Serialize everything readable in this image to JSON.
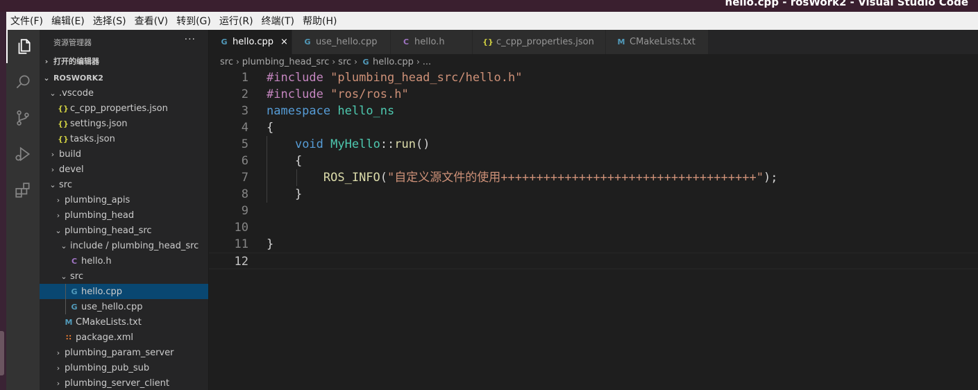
{
  "window": {
    "title": "hello.cpp - rosWork2 - Visual Studio Code"
  },
  "menubar": {
    "items": [
      "文件(F)",
      "编辑(E)",
      "选择(S)",
      "查看(V)",
      "转到(G)",
      "运行(R)",
      "终端(T)",
      "帮助(H)"
    ]
  },
  "activity_bar": {
    "items": [
      {
        "icon": "files-icon",
        "active": true
      },
      {
        "icon": "search-icon",
        "active": false
      },
      {
        "icon": "source-control-icon",
        "active": false
      },
      {
        "icon": "run-debug-icon",
        "active": false
      },
      {
        "icon": "extensions-icon",
        "active": false
      }
    ]
  },
  "sidebar": {
    "title": "资源管理器",
    "more": "···",
    "open_editors": "打开的编辑器",
    "workspace": "ROSWORK2",
    "tree": [
      {
        "label": ".vscode",
        "type": "folder",
        "open": true
      },
      {
        "label": "c_cpp_properties.json",
        "type": "json",
        "icon": "{}"
      },
      {
        "label": "settings.json",
        "type": "json",
        "icon": "{}"
      },
      {
        "label": "tasks.json",
        "type": "json",
        "icon": "{}"
      },
      {
        "label": "build",
        "type": "folder",
        "open": false
      },
      {
        "label": "devel",
        "type": "folder",
        "open": false
      },
      {
        "label": "src",
        "type": "folder",
        "open": true
      },
      {
        "label": "plumbing_apis",
        "type": "folder",
        "open": false
      },
      {
        "label": "plumbing_head",
        "type": "folder",
        "open": false
      },
      {
        "label": "plumbing_head_src",
        "type": "folder",
        "open": true
      },
      {
        "label": "include / plumbing_head_src",
        "type": "folder",
        "open": true
      },
      {
        "label": "hello.h",
        "type": "c",
        "icon": "C"
      },
      {
        "label": "src",
        "type": "folder",
        "open": true
      },
      {
        "label": "hello.cpp",
        "type": "cpp",
        "icon": "G",
        "selected": true
      },
      {
        "label": "use_hello.cpp",
        "type": "cpp",
        "icon": "G"
      },
      {
        "label": "CMakeLists.txt",
        "type": "cmake",
        "icon": "M"
      },
      {
        "label": "package.xml",
        "type": "xml",
        "icon": "∷"
      },
      {
        "label": "plumbing_param_server",
        "type": "folder",
        "open": false
      },
      {
        "label": "plumbing_pub_sub",
        "type": "folder",
        "open": false
      },
      {
        "label": "plumbing_server_client",
        "type": "folder",
        "open": false
      }
    ]
  },
  "tabs": [
    {
      "label": "hello.cpp",
      "icon": "G",
      "type": "cpp",
      "active": true,
      "close": "×"
    },
    {
      "label": "use_hello.cpp",
      "icon": "G",
      "type": "cpp",
      "active": false
    },
    {
      "label": "hello.h",
      "icon": "C",
      "type": "c",
      "active": false
    },
    {
      "label": "c_cpp_properties.json",
      "icon": "{}",
      "type": "json",
      "active": false
    },
    {
      "label": "CMakeLists.txt",
      "icon": "M",
      "type": "cmake",
      "active": false
    }
  ],
  "breadcrumb": {
    "parts": [
      "src",
      "plumbing_head_src",
      "src",
      "hello.cpp",
      "..."
    ],
    "file_icon": "G"
  },
  "editor": {
    "current_line": 12,
    "lines": [
      {
        "num": "1",
        "tokens": [
          {
            "t": "pre",
            "v": "#include "
          },
          {
            "t": "str",
            "v": "\"plumbing_head_src/hello.h\""
          }
        ]
      },
      {
        "num": "2",
        "tokens": [
          {
            "t": "pre",
            "v": "#include "
          },
          {
            "t": "str",
            "v": "\"ros/ros.h\""
          }
        ]
      },
      {
        "num": "3",
        "tokens": [
          {
            "t": "kw",
            "v": "namespace"
          },
          {
            "t": "pl",
            "v": " "
          },
          {
            "t": "ns",
            "v": "hello_ns"
          }
        ]
      },
      {
        "num": "4",
        "tokens": [
          {
            "t": "pl",
            "v": "{"
          }
        ]
      },
      {
        "num": "5",
        "tokens": [
          {
            "t": "pl",
            "v": "    "
          },
          {
            "t": "kw",
            "v": "void"
          },
          {
            "t": "pl",
            "v": " "
          },
          {
            "t": "ns",
            "v": "MyHello"
          },
          {
            "t": "pl",
            "v": "::"
          },
          {
            "t": "fn",
            "v": "run"
          },
          {
            "t": "pl",
            "v": "()"
          }
        ]
      },
      {
        "num": "6",
        "tokens": [
          {
            "t": "pl",
            "v": "    {"
          }
        ]
      },
      {
        "num": "7",
        "tokens": [
          {
            "t": "pl",
            "v": "        "
          },
          {
            "t": "mac",
            "v": "ROS_INFO"
          },
          {
            "t": "pl",
            "v": "("
          },
          {
            "t": "str",
            "v": "\"自定义源文件的使用++++++++++++++++++++++++++++++++++++\""
          },
          {
            "t": "pl",
            "v": ");"
          }
        ]
      },
      {
        "num": "8",
        "tokens": [
          {
            "t": "pl",
            "v": "    }"
          }
        ]
      },
      {
        "num": "9",
        "tokens": []
      },
      {
        "num": "10",
        "tokens": []
      },
      {
        "num": "11",
        "tokens": [
          {
            "t": "pl",
            "v": "}"
          }
        ]
      },
      {
        "num": "12",
        "tokens": []
      }
    ]
  }
}
